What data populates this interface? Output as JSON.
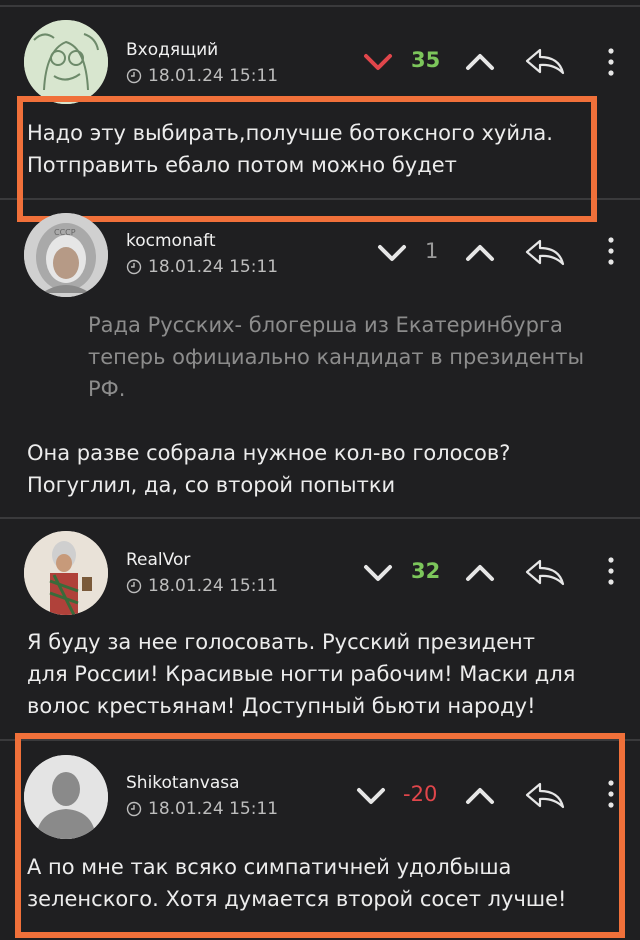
{
  "comments": [
    {
      "author": "Входящий",
      "date": "18.01.24 15:11",
      "score": "35",
      "score_color": "#7cc65b",
      "downvote_color": "#e0464b",
      "text_lines": [
        "Надо эту выбирать,получше ботоксного хуйла.",
        "Потправить ебало потом можно будет"
      ],
      "highlighted": true
    },
    {
      "author": "kocmonaft",
      "date": "18.01.24 15:11",
      "score": "1",
      "score_color": "#9a9a9a",
      "quote_lines": [
        "Рада Русских- блогерша из Екатеринбурга",
        "теперь официально кандидат в президенты",
        "РФ."
      ],
      "text_lines": [
        "Она разве собрала нужное кол-во голосов?",
        "Погуглил, да, со второй попытки"
      ]
    },
    {
      "author": "RealVor",
      "date": "18.01.24 15:11",
      "score": "32",
      "score_color": "#7cc65b",
      "text_lines": [
        "Я буду за нее голосовать. Русский президент",
        "для России! Красивые ногти рабочим! Маски для",
        "волос крестьянам! Доступный бьюти народу!"
      ]
    },
    {
      "author": "Shikotanvasa",
      "date": "18.01.24 15:11",
      "score": "-20",
      "score_color": "#e0464b",
      "text_lines": [
        "А по мне так всяко симпатичней удолбыша",
        "зеленского. Хотя думается второй сосет лучше!"
      ],
      "highlighted": true
    }
  ],
  "icons": {
    "downvote": "chevron-down-icon",
    "upvote": "chevron-up-icon",
    "reply": "reply-arrow-icon",
    "more": "more-vertical-icon",
    "clock": "clock-icon"
  },
  "highlight_color": "#f0703a"
}
